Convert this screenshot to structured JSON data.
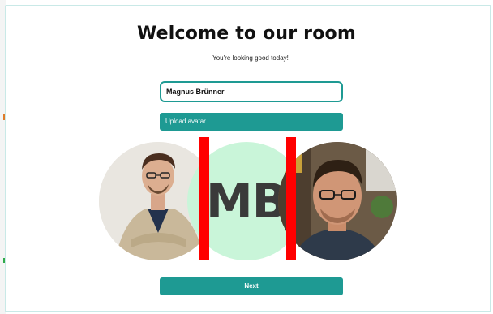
{
  "page": {
    "title": "Welcome to our room",
    "subtitle": "You're looking good today!"
  },
  "form": {
    "name_value": "Magnus Brünner",
    "upload_label": "Upload avatar",
    "next_label": "Next"
  },
  "avatars": [
    {
      "kind": "photo",
      "name": "avatar-photo-1",
      "selected": false
    },
    {
      "kind": "initials",
      "initials": "MB",
      "color": "#c9f5d9",
      "selected": true
    },
    {
      "kind": "photo",
      "name": "avatar-photo-2",
      "selected": false
    }
  ],
  "colors": {
    "accent": "#1e9a93",
    "selection": "#ff0000",
    "initials_bg": "#c9f5d9"
  }
}
